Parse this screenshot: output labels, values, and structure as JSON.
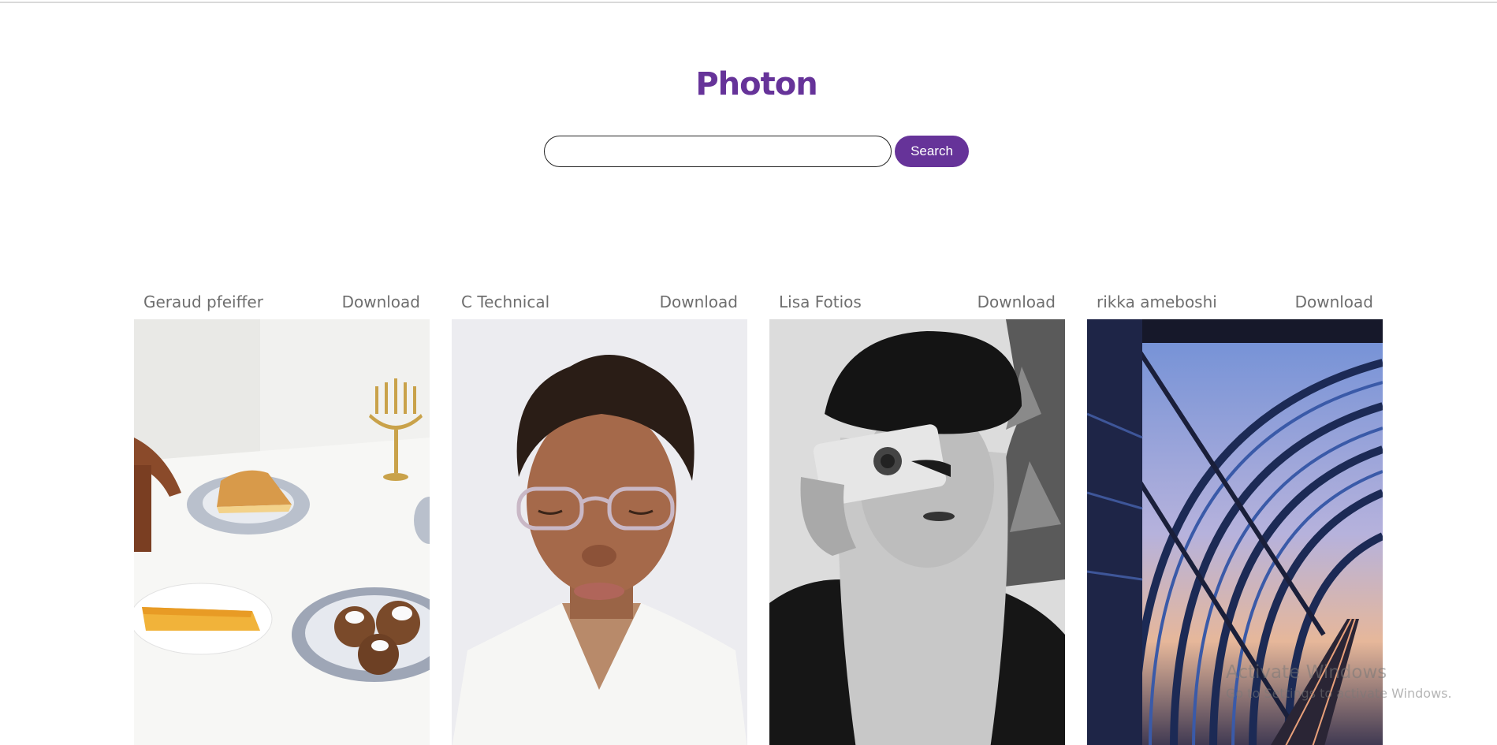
{
  "app": {
    "title": "Photon"
  },
  "search": {
    "placeholder": "",
    "value": "",
    "button_label": "Search"
  },
  "photos": [
    {
      "author": "Geraud pfeiffer",
      "download_label": "Download",
      "subject": "table with dessert plates and menorah"
    },
    {
      "author": "C Technical",
      "download_label": "Download",
      "subject": "portrait of woman with glasses"
    },
    {
      "author": "Lisa Fotios",
      "download_label": "Download",
      "subject": "black and white woman holding camera"
    },
    {
      "author": "rikka ameboshi",
      "download_label": "Download",
      "subject": "train station arched glass roof at dusk"
    }
  ],
  "watermark": {
    "title": "Activate Windows",
    "subtitle": "Go to Settings to activate Windows."
  },
  "colors": {
    "accent": "#663399",
    "author_text": "#6e6e6e"
  }
}
